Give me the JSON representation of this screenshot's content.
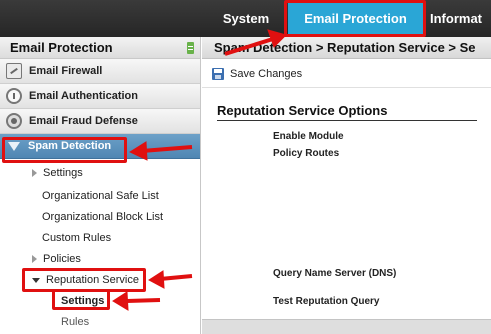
{
  "topnav": {
    "tabs": [
      {
        "label": "System"
      },
      {
        "label": "Email Protection"
      },
      {
        "label": "Informat"
      }
    ]
  },
  "sidebar": {
    "title": "Email Protection",
    "collapse_icon": "collapse-icon",
    "sections": [
      {
        "label": "Email Firewall",
        "icon": "firewall-icon"
      },
      {
        "label": "Email Authentication",
        "icon": "authentication-icon"
      },
      {
        "label": "Email Fraud Defense",
        "icon": "fraud-defense-icon"
      },
      {
        "label": "Spam Detection",
        "icon": "funnel-icon"
      }
    ],
    "tree": [
      {
        "label": "Settings"
      },
      {
        "label": "Organizational Safe List"
      },
      {
        "label": "Organizational Block List"
      },
      {
        "label": "Custom Rules"
      },
      {
        "label": "Policies"
      },
      {
        "label": "Reputation Service"
      },
      {
        "label": "Settings"
      },
      {
        "label": "Rules"
      }
    ]
  },
  "main": {
    "breadcrumb": "Spam Detection > Reputation Service > Se",
    "toolbar": {
      "save_label": "Save Changes",
      "save_icon": "save-icon"
    },
    "section_title": "Reputation Service Options",
    "fields": {
      "enable_module": "Enable Module",
      "policy_routes": "Policy Routes",
      "query_dns": "Query Name Server (DNS)",
      "test_query": "Test Reputation Query"
    }
  },
  "colors": {
    "active_tab": "#2aa6d6",
    "selected_section": "#5a90bb",
    "annotation": "#e01010"
  }
}
